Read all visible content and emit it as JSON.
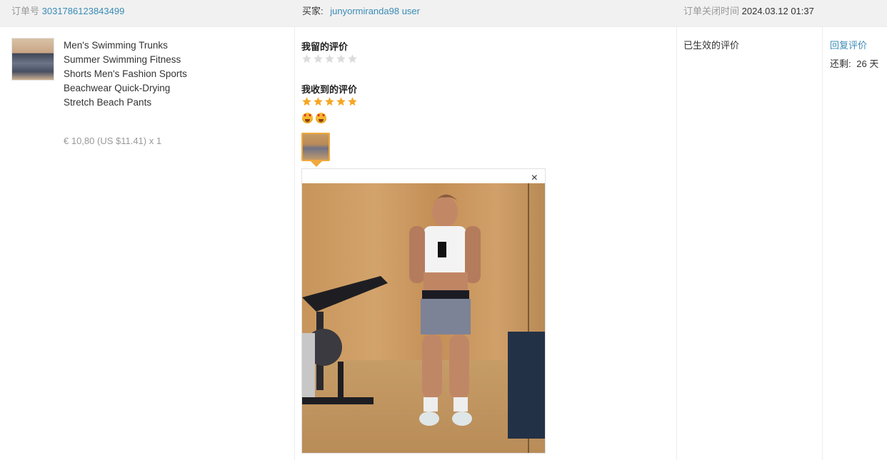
{
  "header": {
    "order_label": "订单号",
    "order_number": "3031786123843499",
    "buyer_label": "买家:",
    "buyer_name": "junyormiranda98 user",
    "closed_label": "订单关闭时间",
    "closed_time": "2024.03.12 01:37"
  },
  "product": {
    "title": "Men's Swimming Trunks Summer Swimming Fitness Shorts Men's Fashion Sports Beachwear Quick-Drying Stretch Beach Pants",
    "price": "€ 10,80 (US $11.41) x 1"
  },
  "my_review": {
    "title": "我留的评价",
    "rating": 0,
    "max_rating": 5
  },
  "received_review": {
    "title": "我收到的评价",
    "rating": 5,
    "max_rating": 5,
    "emojis": [
      "heart-eyes-emoji",
      "heart-eyes-emoji"
    ],
    "close_glyph": "×"
  },
  "status": {
    "text": "已生效的评价"
  },
  "actions": {
    "reply_label": "回复评价",
    "remaining_label": "还剩:",
    "remaining_value": "26 天"
  },
  "colors": {
    "link": "#3a8bb7",
    "star_active": "#f5a623",
    "star_inactive": "#dcdcdc",
    "thumb_border": "#f0a93c"
  }
}
